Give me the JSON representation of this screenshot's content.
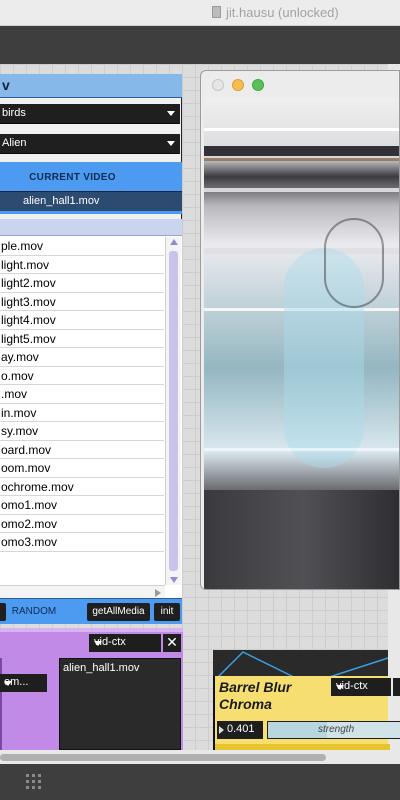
{
  "window": {
    "title": "jit.hausu (unlocked)"
  },
  "player": {
    "folder_dropdown": "birds",
    "subfolder_dropdown": "Alien",
    "current_video_title": "CURRENT VIDEO",
    "current_video_file": "alien_hall1.mov",
    "files": [
      "ple.mov",
      "light.mov",
      "light2.mov",
      "light3.mov",
      "light4.mov",
      "light5.mov",
      "ay.mov",
      "o.mov",
      ".mov",
      "in.mov",
      "sy.mov",
      "oard.mov",
      "oom.mov",
      "ochrome.mov",
      "omo1.mov",
      "omo2.mov",
      "omo3.mov"
    ],
    "buttons": {
      "random": "RANDOM",
      "get_all_media": "getAllMedia",
      "init": "init"
    }
  },
  "vid_ctx_panel": {
    "context_select": "vid-ctx",
    "close_symbol": "✕",
    "mode_select": "em...",
    "message_text": "alien_hall1.mov"
  },
  "barrel": {
    "title": "Barrel Blur Chroma",
    "context_select": "vid-ctx",
    "value": "0.401",
    "slider_label": "strength",
    "slider_fraction": 0.4
  },
  "colors": {
    "player_header": "#86b9ea",
    "player_accent": "#4d9bf0",
    "purple_panel": "#c08ae6",
    "barrel_panel": "#f7de70"
  },
  "icons": {
    "doc": "document-icon",
    "close": "close-icon",
    "grid": "grid-icon",
    "dropdown": "chevron-down-icon"
  }
}
